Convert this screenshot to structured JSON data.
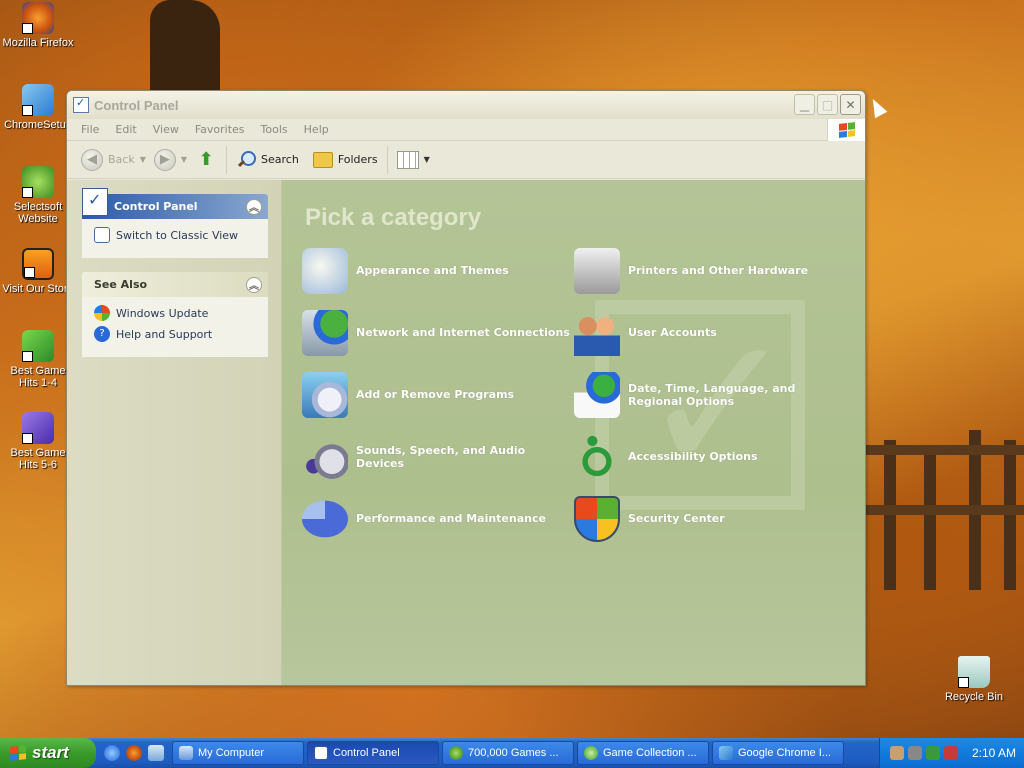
{
  "desktop": {
    "icons": [
      {
        "label": "Mozilla Firefox"
      },
      {
        "label": "ChromeSetup"
      },
      {
        "label": "Selectsoft Website"
      },
      {
        "label": "Visit Our Store"
      },
      {
        "label": "Best Game Hits 1-4"
      },
      {
        "label": "Best Game Hits 5-6"
      },
      {
        "label": "Recycle Bin"
      }
    ]
  },
  "window": {
    "title": "Control Panel",
    "menu": [
      "File",
      "Edit",
      "View",
      "Favorites",
      "Tools",
      "Help"
    ],
    "toolbar": {
      "back": "Back",
      "search": "Search",
      "folders": "Folders"
    }
  },
  "taskpane": {
    "control_panel": {
      "title": "Control Panel",
      "link": "Switch to Classic View"
    },
    "see_also": {
      "title": "See Also",
      "links": [
        "Windows Update",
        "Help and Support"
      ]
    }
  },
  "main": {
    "heading": "Pick a category",
    "categories": [
      {
        "label": "Appearance and Themes",
        "icon": "appearance-icon"
      },
      {
        "label": "Printers and Other Hardware",
        "icon": "printer-icon"
      },
      {
        "label": "Network and Internet Connections",
        "icon": "network-icon"
      },
      {
        "label": "User Accounts",
        "icon": "users-icon"
      },
      {
        "label": "Add or Remove Programs",
        "icon": "programs-icon"
      },
      {
        "label": "Date, Time, Language, and Regional Options",
        "icon": "calendar-globe-icon"
      },
      {
        "label": "Sounds, Speech, and Audio Devices",
        "icon": "sound-icon"
      },
      {
        "label": "Accessibility Options",
        "icon": "accessibility-icon"
      },
      {
        "label": "Performance and Maintenance",
        "icon": "performance-icon"
      },
      {
        "label": "Security Center",
        "icon": "shield-icon"
      }
    ]
  },
  "taskbar": {
    "start": "start",
    "tasks": [
      {
        "label": "My Computer"
      },
      {
        "label": "Control Panel"
      },
      {
        "label": "700,000 Games ..."
      },
      {
        "label": "Game Collection ..."
      },
      {
        "label": "Google Chrome I..."
      }
    ],
    "clock": "2:10 AM"
  },
  "colors": {
    "xp_blue": "#2264c8",
    "start_green": "#3a9a2a",
    "category_bg": "#b4c496"
  }
}
